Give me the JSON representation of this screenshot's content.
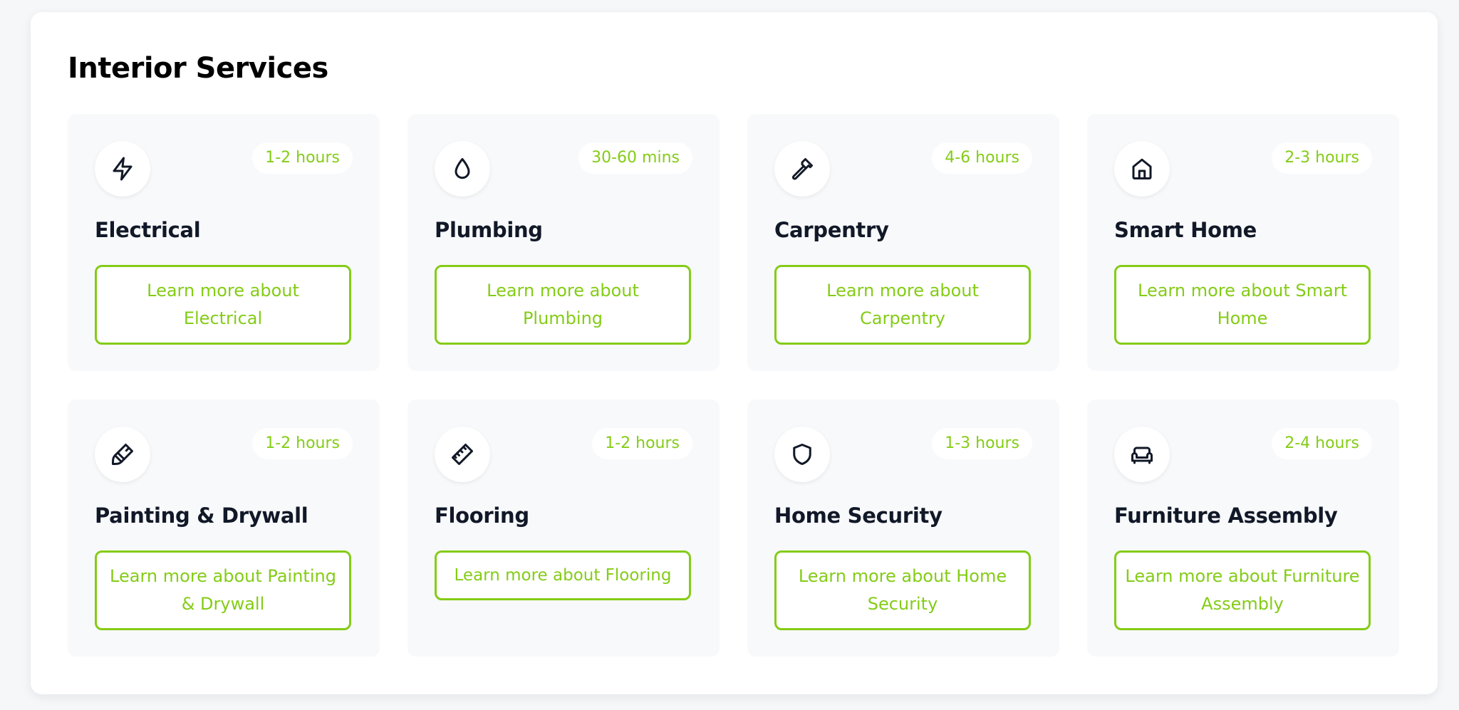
{
  "section": {
    "title": "Interior Services"
  },
  "colors": {
    "accent": "#84cc16",
    "text_dark": "#111827",
    "card_bg": "#f8f9fb"
  },
  "services": [
    {
      "name": "Electrical",
      "duration": "1-2 hours",
      "button": "Learn more about Electrical",
      "icon": "lightning-bolt-icon"
    },
    {
      "name": "Plumbing",
      "duration": "30-60 mins",
      "button": "Learn more about Plumbing",
      "icon": "water-drop-icon"
    },
    {
      "name": "Carpentry",
      "duration": "4-6 hours",
      "button": "Learn more about Carpentry",
      "icon": "hammer-icon"
    },
    {
      "name": "Smart Home",
      "duration": "2-3 hours",
      "button": "Learn more about Smart Home",
      "icon": "house-icon"
    },
    {
      "name": "Painting & Drywall",
      "duration": "1-2 hours",
      "button": "Learn more about Painting & Drywall",
      "icon": "paintbrush-icon"
    },
    {
      "name": "Flooring",
      "duration": "1-2 hours",
      "button": "Learn more about Flooring",
      "icon": "ruler-icon"
    },
    {
      "name": "Home Security",
      "duration": "1-3 hours",
      "button": "Learn more about Home Security",
      "icon": "shield-icon"
    },
    {
      "name": "Furniture Assembly",
      "duration": "2-4 hours",
      "button": "Learn more about Furniture Assembly",
      "icon": "sofa-icon"
    }
  ]
}
